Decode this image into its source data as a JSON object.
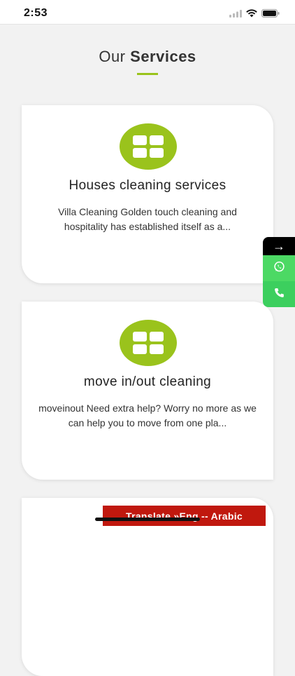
{
  "status": {
    "time": "2:53"
  },
  "section": {
    "title_light": "Our",
    "title_bold": "Services"
  },
  "cards": [
    {
      "icon": "grid-icon",
      "title": "Houses cleaning services",
      "description": "Villa Cleaning Golden touch cleaning and hospitality has established itself as a..."
    },
    {
      "icon": "grid-icon",
      "title": "move in/out cleaning",
      "description": "moveinout Need extra help? Worry no more as we can help you to move from one pla..."
    }
  ],
  "side_actions": {
    "arrow": "→",
    "whatsapp_icon": "whatsapp-icon",
    "phone_icon": "phone-icon"
  },
  "translate": {
    "label": "Translate »Eng -- Arabic"
  },
  "colors": {
    "accent": "#9ac31c",
    "whatsapp": "#4cd964",
    "translate_bg": "#c0180e"
  }
}
